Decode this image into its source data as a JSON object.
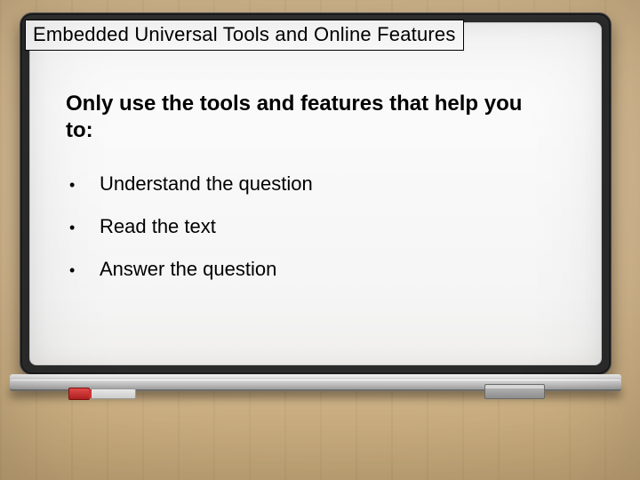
{
  "title": "Embedded Universal Tools and Online Features",
  "subheading": "Only use the tools and features that help you to:",
  "bullets": [
    "Understand the question",
    "Read the text",
    "Answer the question"
  ]
}
